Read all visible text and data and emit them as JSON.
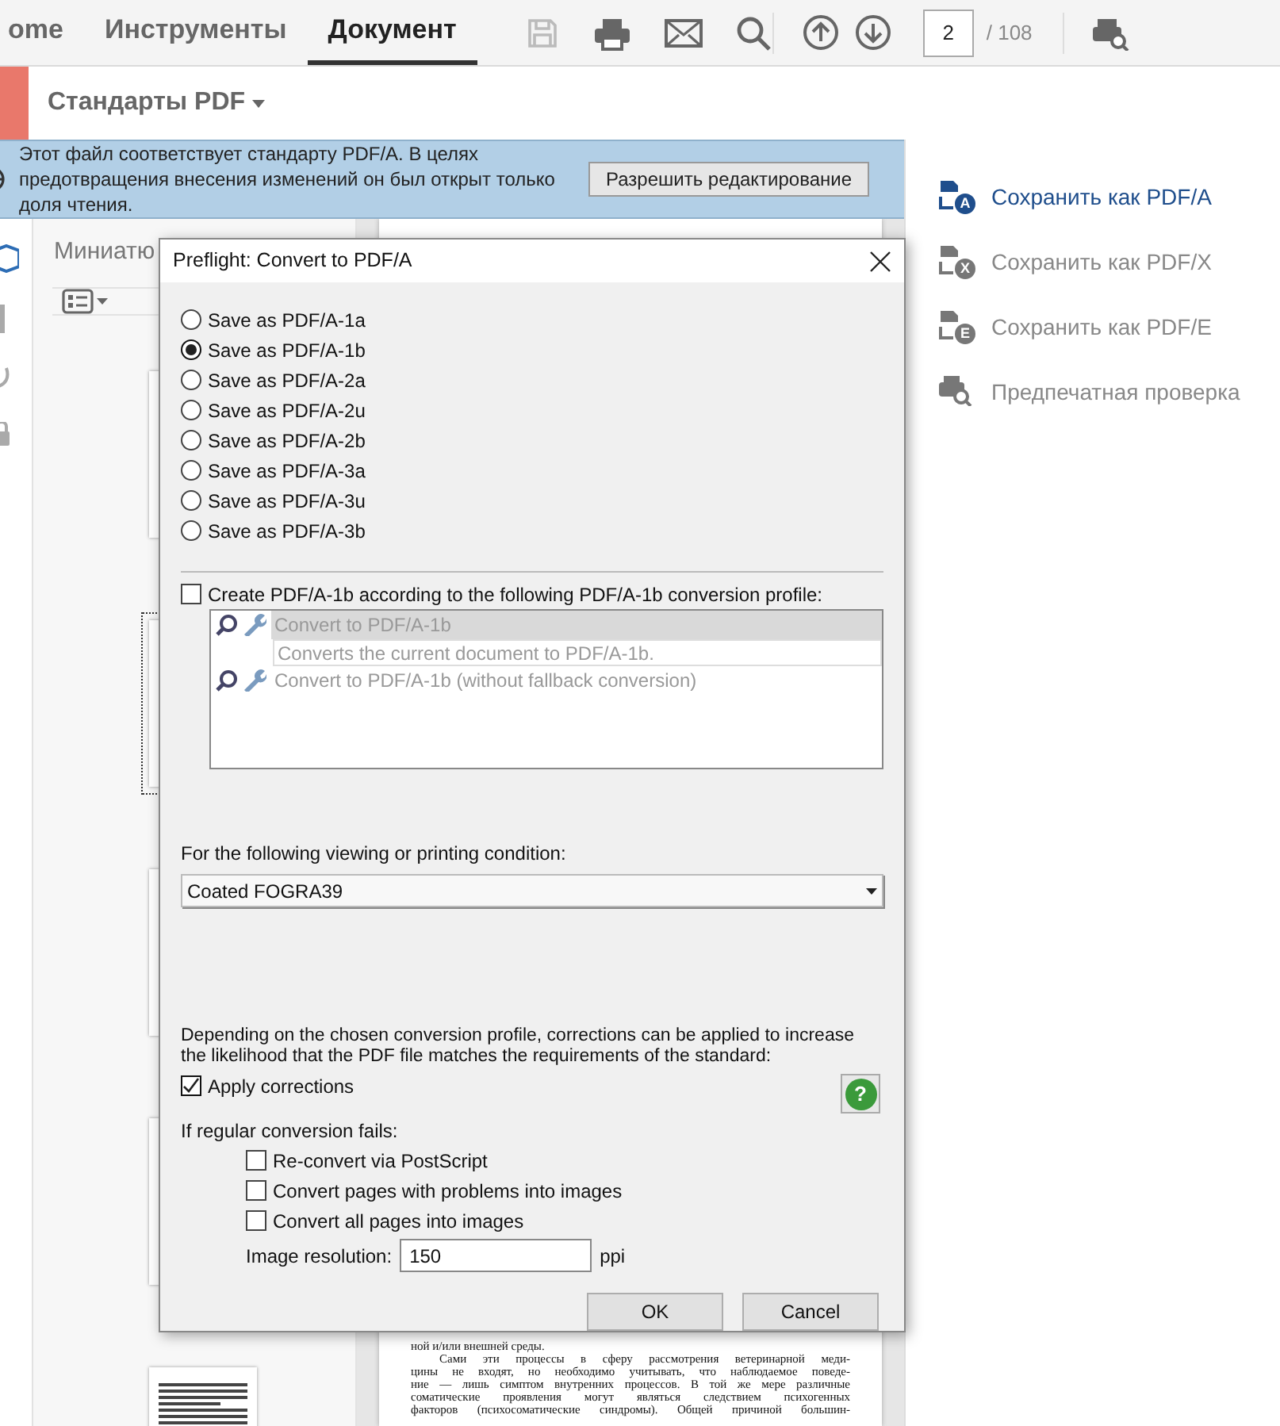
{
  "toolbar": {
    "tabs": [
      {
        "label": "ome",
        "selected": false
      },
      {
        "label": "Инструменты",
        "selected": false
      },
      {
        "label": "Документ",
        "selected": true
      }
    ],
    "page_number": "2",
    "page_count": "/ 108"
  },
  "tool_header": {
    "title": "Стандарты PDF"
  },
  "info_bar": {
    "message": "Этот файл соответствует стандарту PDF/A. В целях предотвращения внесения изменений он был открыт только доля чтения.",
    "button": "Разрешить редактирование"
  },
  "thumbnails_panel": {
    "title": "Миниатю",
    "pages": [
      {
        "selected": false
      },
      {
        "selected": true
      },
      {
        "selected": false
      },
      {
        "selected": false
      },
      {
        "selected": false
      }
    ]
  },
  "document": {
    "paragraphs": [
      {
        "lines": [
          "ной и/или внешней среды."
        ]
      },
      {
        "lines": [
          "Сами эти процессы в сферу рассмотрения ветеринарной меди-",
          "цины не входят, но необходимо учитывать, что наблюдаемое поведе-",
          "ние — лишь симптом внутренних процессов. В той же мере различные",
          "соматические проявления могут являться следствием психогенных",
          "факторов (психосоматические синдромы). Общей причиной большин-"
        ]
      }
    ]
  },
  "right_panel": {
    "items": [
      {
        "kind": "standard",
        "label": "Сохранить как PDF/A",
        "badge": "A",
        "active": true
      },
      {
        "kind": "standard",
        "label": "Сохранить как PDF/X",
        "badge": "X",
        "active": false
      },
      {
        "kind": "standard",
        "label": "Сохранить как PDF/E",
        "badge": "E",
        "active": false
      },
      {
        "kind": "preflight",
        "label": "Предпечатная проверка",
        "active": false
      }
    ]
  },
  "dialog": {
    "title": "Preflight: Convert to PDF/A",
    "formats": [
      {
        "label": "Save as PDF/A-1a",
        "selected": false
      },
      {
        "label": "Save as PDF/A-1b",
        "selected": true
      },
      {
        "label": "Save as PDF/A-2a",
        "selected": false
      },
      {
        "label": "Save as PDF/A-2u",
        "selected": false
      },
      {
        "label": "Save as PDF/A-2b",
        "selected": false
      },
      {
        "label": "Save as PDF/A-3a",
        "selected": false
      },
      {
        "label": "Save as PDF/A-3u",
        "selected": false
      },
      {
        "label": "Save as PDF/A-3b",
        "selected": false
      }
    ],
    "profile_option": {
      "label": "Create PDF/A-1b according to the following PDF/A-1b conversion profile:",
      "checked": false
    },
    "profiles": {
      "disabled": true,
      "items": [
        {
          "name": "Convert to PDF/A-1b",
          "description": "Converts the current document to PDF/A-1b.",
          "selected": true
        },
        {
          "name": "Convert to PDF/A-1b (without fallback conversion)",
          "selected": false
        }
      ]
    },
    "condition_label": "For the following viewing or printing condition:",
    "condition_value": "Coated FOGRA39",
    "corrections_note": "Depending on the chosen conversion profile, corrections can be applied to increase the likelihood that the PDF file matches the requirements of the standard:",
    "apply_corrections": {
      "label": "Apply corrections",
      "checked": true
    },
    "help_button": "?",
    "fallback_label": "If regular conversion fails:",
    "fallback_options": [
      {
        "label": "Re-convert via PostScript",
        "checked": false
      },
      {
        "label": "Convert pages with problems into images",
        "checked": false
      },
      {
        "label": "Convert all pages into images",
        "checked": false
      }
    ],
    "resolution_label": "Image resolution:",
    "resolution_value": "150",
    "resolution_unit": "ppi",
    "buttons": [
      "OK",
      "Cancel"
    ]
  }
}
